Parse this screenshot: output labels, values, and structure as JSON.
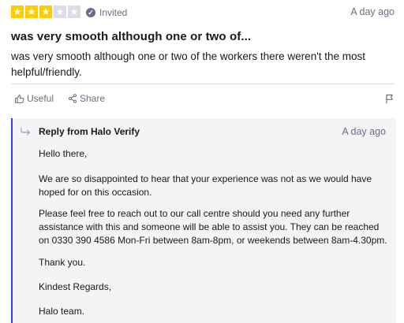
{
  "review": {
    "rating": 3,
    "max_rating": 5,
    "star_glyph": "★",
    "status_icon": "check-circle-icon",
    "status": "Invited",
    "date": "A day ago",
    "title": "was very smooth although one or two of...",
    "body": "was very smooth although one or two of the workers there weren't the most helpful/friendly."
  },
  "actions": {
    "useful_label": "Useful",
    "share_label": "Share",
    "useful_icon": "thumbs-up-icon",
    "share_icon": "share-icon",
    "flag_icon": "flag-icon"
  },
  "reply": {
    "icon": "reply-arrow-icon",
    "title": "Reply from Halo Verify",
    "date": "A day ago",
    "paragraphs": [
      "Hello there,",
      "We are so disappointed to hear that your experience was not as we would have hoped for on this occasion.",
      "Please feel free to reach out to our call centre should you need any further assistance with this and someone will be able to assist you. They can be reached on 0330 390 4586 Mon-Fri between 8am-8pm, or weekends between 8am-4.30pm.",
      "Thank you.",
      "Kindest Regards,",
      "Halo team."
    ]
  },
  "colors": {
    "star_filled": "#ffce00",
    "star_empty": "#dcdce6",
    "reply_accent": "#3c3ce8",
    "reply_background": "#f4f4f6",
    "muted_text": "#6c6c85"
  }
}
